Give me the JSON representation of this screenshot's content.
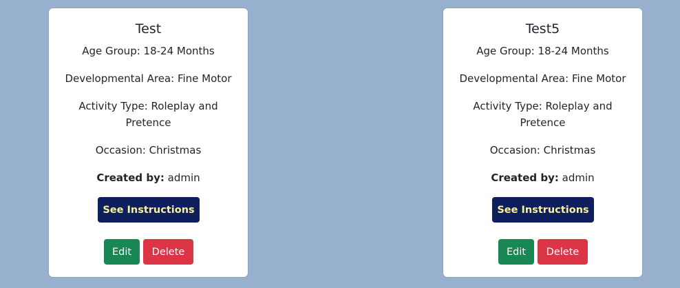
{
  "cards": [
    {
      "title": "Test",
      "age_group": "Age Group: 18-24 Months",
      "developmental_area": "Developmental Area: Fine Motor",
      "activity_type": "Activity Type: Roleplay and Pretence",
      "occasion": "Occasion: Christmas",
      "created_by_label": "Created by:",
      "created_by_value": " admin",
      "instructions_label": "See Instructions",
      "edit_label": "Edit",
      "delete_label": "Delete"
    },
    {
      "title": "Test5",
      "age_group": "Age Group: 18-24 Months",
      "developmental_area": "Developmental Area: Fine Motor",
      "activity_type": "Activity Type: Roleplay and Pretence",
      "occasion": "Occasion: Christmas",
      "created_by_label": "Created by:",
      "created_by_value": " admin",
      "instructions_label": "See Instructions",
      "edit_label": "Edit",
      "delete_label": "Delete"
    }
  ],
  "colors": {
    "background": "#96b0cd",
    "instructions_button": "#0f1f5e",
    "instructions_text": "#f8f39a",
    "edit_button": "#198754",
    "delete_button": "#dc3545"
  }
}
